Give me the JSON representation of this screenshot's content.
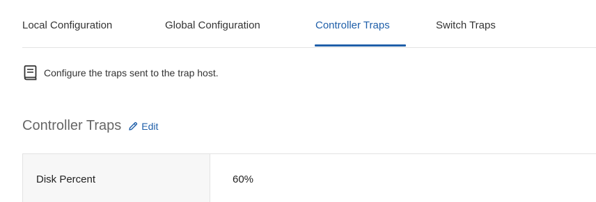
{
  "tabs": [
    {
      "label": "Local Configuration"
    },
    {
      "label": "Global Configuration"
    },
    {
      "label": "Controller Traps",
      "active": true
    },
    {
      "label": "Switch Traps"
    }
  ],
  "description": {
    "icon": "book-icon",
    "text": "Configure the traps sent to the trap host."
  },
  "section": {
    "title": "Controller Traps",
    "edit_label": "Edit",
    "edit_icon": "pencil-icon"
  },
  "table": {
    "rows": [
      {
        "label": "Disk Percent",
        "value": "60%"
      }
    ]
  },
  "colors": {
    "accent": "#1f5fa9",
    "border": "#e3e3e3",
    "label_bg": "#f7f7f7"
  }
}
